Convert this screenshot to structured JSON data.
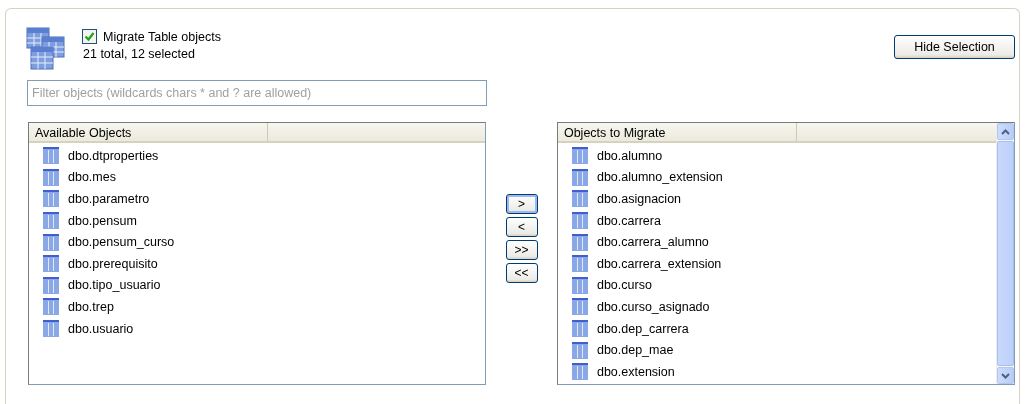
{
  "header": {
    "checkbox": {
      "label": "Migrate Table objects",
      "checked": true
    },
    "summary": "21 total, 12 selected"
  },
  "hide_selection_button": "Hide Selection",
  "filter": {
    "placeholder": "Filter objects (wildcards chars * and ? are allowed)"
  },
  "available": {
    "column": "Available Objects",
    "items": [
      "dbo.dtproperties",
      "dbo.mes",
      "dbo.parametro",
      "dbo.pensum",
      "dbo.pensum_curso",
      "dbo.prerequisito",
      "dbo.tipo_usuario",
      "dbo.trep",
      "dbo.usuario"
    ]
  },
  "move_buttons": [
    {
      "label": ">",
      "focused": true
    },
    {
      "label": "<",
      "focused": false
    },
    {
      "label": ">>",
      "focused": false
    },
    {
      "label": "<<",
      "focused": false
    }
  ],
  "to_migrate": {
    "column": "Objects to Migrate",
    "items": [
      "dbo.alumno",
      "dbo.alumno_extension",
      "dbo.asignacion",
      "dbo.carrera",
      "dbo.carrera_alumno",
      "dbo.carrera_extension",
      "dbo.curso",
      "dbo.curso_asignado",
      "dbo.dep_carrera",
      "dbo.dep_mae",
      "dbo.extension"
    ]
  }
}
